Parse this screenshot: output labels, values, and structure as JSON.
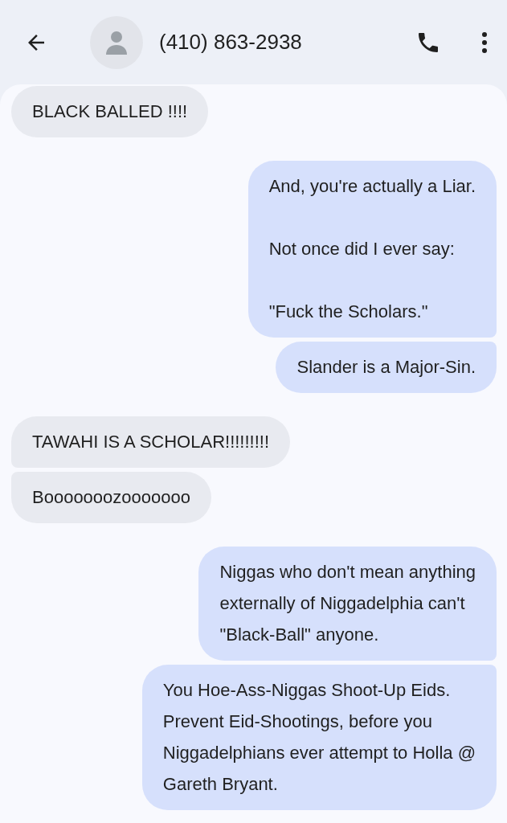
{
  "header": {
    "title": "(410) 863-2938"
  },
  "messages": [
    {
      "kind": "in",
      "text": "BLACK BALLED !!!!"
    },
    {
      "kind": "out",
      "text": "And, you're actually a Liar.\n\nNot once did I ever say:\n\n\"Fuck the Scholars.\""
    },
    {
      "kind": "out",
      "text": "Slander is a Major-Sin."
    },
    {
      "kind": "in",
      "text": "TAWAHI IS A SCHOLAR!!!!!!!!!"
    },
    {
      "kind": "in",
      "text": "Booooooozooooooo"
    },
    {
      "kind": "out",
      "text": "Niggas who don't mean anything\nexternally of Niggadelphia can't\n\"Black-Ball\" anyone."
    },
    {
      "kind": "out",
      "text": "You Hoe-Ass-Niggas Shoot-Up Eids.\nPrevent Eid-Shootings, before you\nNiggadelphians ever attempt to Holla @\nGareth Bryant."
    }
  ]
}
